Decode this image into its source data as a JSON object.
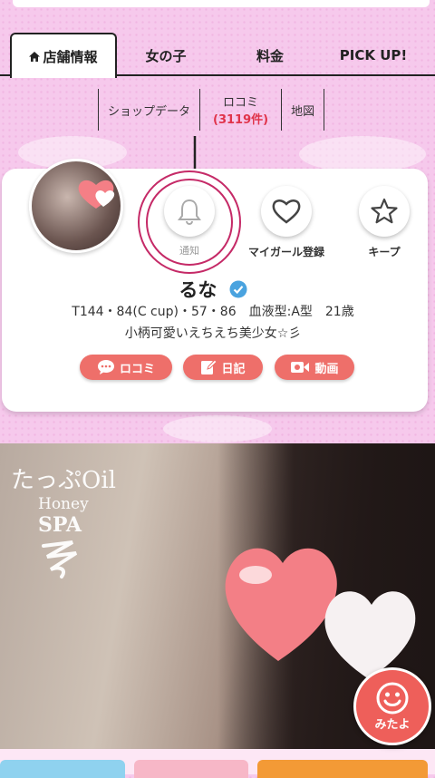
{
  "tabs": [
    {
      "label": "店舗情報",
      "active": true
    },
    {
      "label": "女の子"
    },
    {
      "label": "料金"
    },
    {
      "label": "PICK UP!"
    }
  ],
  "subnav": {
    "shop_data": "ショップデータ",
    "review_label": "ロコミ",
    "review_count": "(3119件)",
    "map": "地図"
  },
  "profile": {
    "actions": {
      "notify": "通知",
      "my_girl": "マイガール登録",
      "keep": "キープ"
    },
    "name": "るな",
    "spec": "T144・84(C cup)・57・86　血液型:A型　21歳",
    "catch": "小柄可愛いえちえち美少女☆彡",
    "buttons": {
      "review": "ロコミ",
      "diary": "日記",
      "video": "動画"
    }
  },
  "photo": {
    "logo_line1": "たっぷOil",
    "logo_line2": "Honey",
    "logo_line3": "SPA"
  },
  "fab": {
    "label": "みたよ"
  },
  "colors": {
    "accent": "#ee6f6a",
    "highlight_ring": "#c52a67",
    "review_count": "#e0334a",
    "background": "#f6c9ec"
  }
}
